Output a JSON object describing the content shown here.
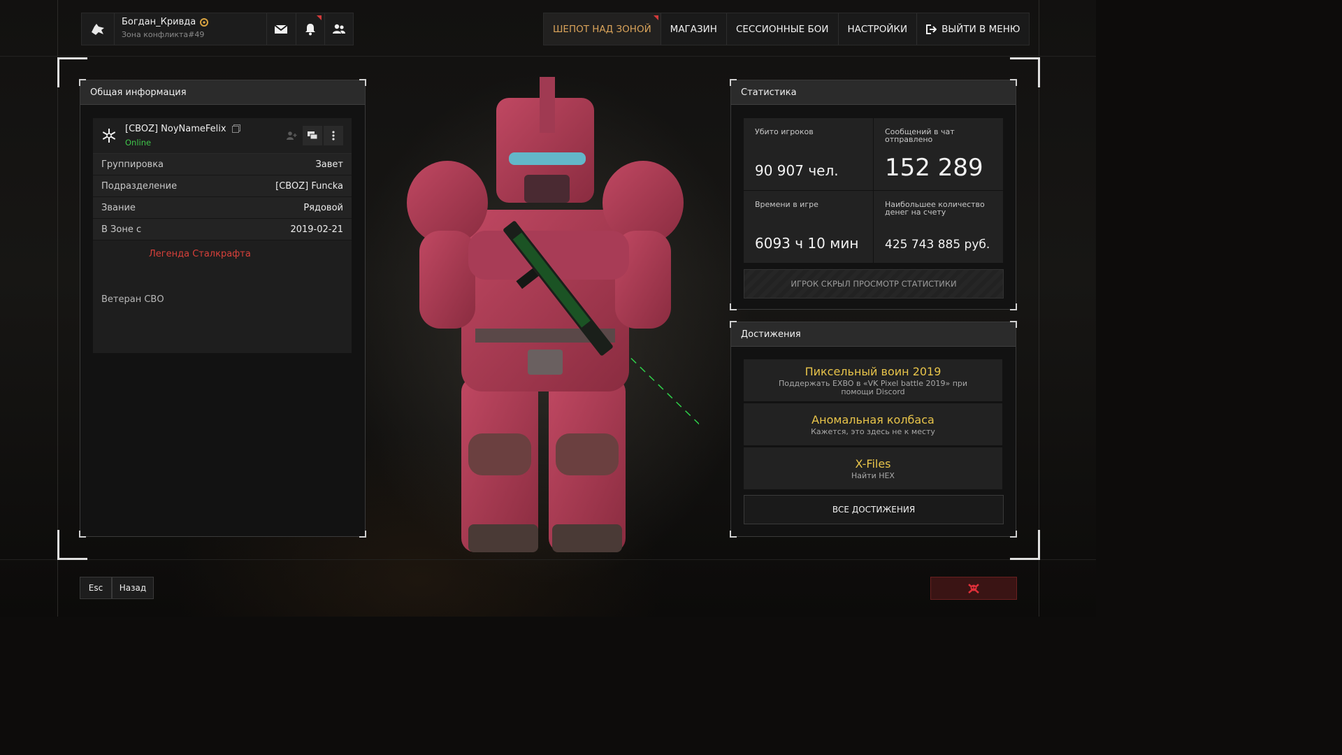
{
  "player": {
    "name": "Богдан_Кривда",
    "zone": "Зона конфликта#49"
  },
  "nav": {
    "items": [
      "ШЕПОТ НАД ЗОНОЙ",
      "МАГАЗИН",
      "СЕССИОННЫЕ БОИ",
      "НАСТРОЙКИ"
    ],
    "exit": "ВЫЙТИ В МЕНЮ"
  },
  "info": {
    "title": "Общая информация",
    "username": "[CBOZ] NoyNameFelix",
    "status": "Online",
    "rows": [
      {
        "label": "Группировка",
        "value": "Завет"
      },
      {
        "label": "Подразделение",
        "value": "[CBOZ] Funcka"
      },
      {
        "label": "Звание",
        "value": "Рядовой"
      },
      {
        "label": "В Зоне с",
        "value": "2019-02-21"
      }
    ],
    "legend": "Легенда Сталкрафта",
    "veteran": "Ветеран СВО"
  },
  "stats": {
    "title": "Статистика",
    "killed_label": "Убито игроков",
    "killed_value": "90 907 чел.",
    "messages_label": "Сообщений в чат отправлено",
    "messages_value": "152 289",
    "time_label": "Времени в игре",
    "time_value": "6093 ч 10 мин",
    "money_label": "Наибольшее количество денег на счету",
    "money_value": "425 743 885 руб.",
    "hidden_notice": "ИГРОК СКРЫЛ ПРОСМОТР СТАТИСТИКИ"
  },
  "achievements": {
    "title": "Достижения",
    "items": [
      {
        "title": "Пиксельный воин 2019",
        "desc": "Поддержать EXBO в «VK Pixel battle 2019» при помощи Discord"
      },
      {
        "title": "Аномальная колбаса",
        "desc": "Кажется, это здесь не к месту"
      },
      {
        "title": "X-Files",
        "desc": "Найти HEX"
      }
    ],
    "all_label": "ВСЕ ДОСТИЖЕНИЯ"
  },
  "footer": {
    "esc": "Esc",
    "back": "Назад"
  },
  "icons": {
    "logo": "wolf-head-icon",
    "mail": "mail-icon",
    "bell": "bell-icon",
    "friends": "friends-icon",
    "exit": "exit-icon",
    "faction": "snowflake-faction-icon",
    "kill": "skull-crossbones-icon"
  },
  "colors": {
    "accent": "#d9a35a",
    "online": "#3fc44a",
    "legend": "#d8403a",
    "achievement": "#e8c44a",
    "armor": "#b03a52"
  }
}
